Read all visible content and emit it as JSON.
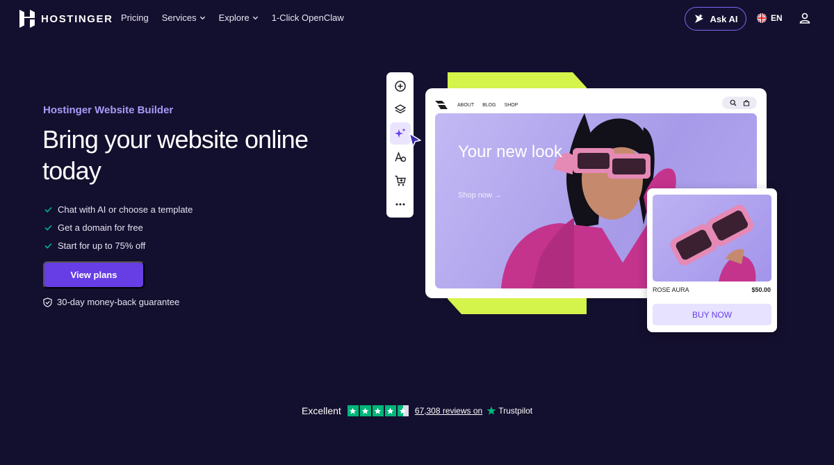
{
  "brand": {
    "name": "HOSTINGER"
  },
  "nav": {
    "links": [
      {
        "label": "Pricing",
        "has_dropdown": false
      },
      {
        "label": "Services",
        "has_dropdown": true
      },
      {
        "label": "Explore",
        "has_dropdown": true
      },
      {
        "label": "1-Click OpenClaw",
        "has_dropdown": false
      }
    ],
    "ask_ai": "Ask AI",
    "language": "EN"
  },
  "hero": {
    "eyebrow": "Hostinger Website Builder",
    "headline": "Bring your website online today",
    "features": [
      "Chat with AI or choose a template",
      "Get a domain for free",
      "Start for up to 75% off"
    ],
    "cta_label": "View plans",
    "guarantee": "30-day money-back guarantee"
  },
  "builder_preview": {
    "toolbar_icons": [
      "add-icon",
      "layers-icon",
      "ai-sparkle-icon",
      "typography-icon",
      "cart-icon",
      "more-icon"
    ],
    "active_tool": "ai-sparkle-icon",
    "site_nav": [
      "ABOUT",
      "BLOG",
      "SHOP"
    ],
    "site_title": "Your new look",
    "site_shop_link": "Shop now →",
    "product": {
      "name": "ROSE AURA",
      "price": "$50.00",
      "button": "BUY NOW"
    }
  },
  "trustpilot": {
    "label": "Excellent",
    "rating_stars": 4.5,
    "reviews_text": "67,308 reviews on",
    "brand": "Trustpilot"
  },
  "colors": {
    "background": "#130f2e",
    "accent_purple": "#673de6",
    "eyebrow_purple": "#a59cf7",
    "lime": "#d4f34b",
    "check_green": "#00b090",
    "trustpilot_green": "#00b67a"
  }
}
